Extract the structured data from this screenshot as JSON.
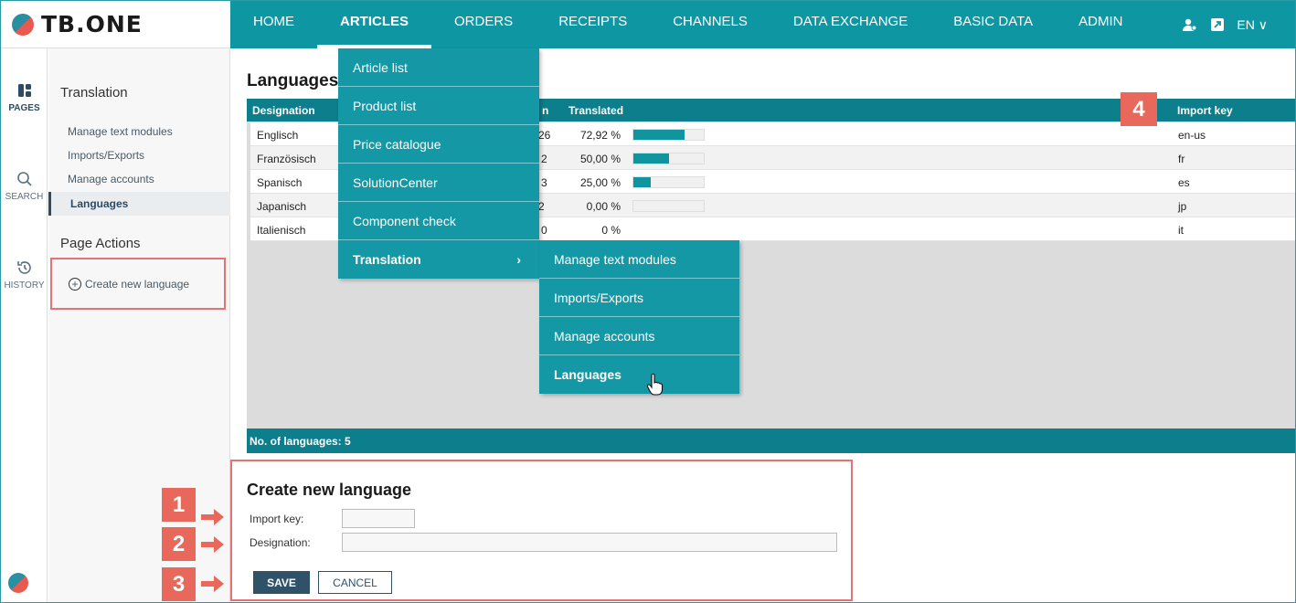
{
  "app": {
    "logo_text": "TB.ONE"
  },
  "nav": {
    "items": [
      "HOME",
      "ARTICLES",
      "ORDERS",
      "RECEIPTS",
      "CHANNELS",
      "DATA EXCHANGE",
      "BASIC DATA",
      "ADMIN"
    ],
    "active": "ARTICLES",
    "lang": "EN"
  },
  "rail": {
    "pages": "PAGES",
    "search": "SEARCH",
    "history": "HISTORY"
  },
  "side": {
    "section_title": "Translation",
    "links": [
      "Manage text modules",
      "Imports/Exports",
      "Manage accounts"
    ],
    "active_link": "Languages",
    "actions_title": "Page Actions",
    "create_link": "Create new language"
  },
  "main": {
    "title": "Languages",
    "columns": {
      "designation": "Designation",
      "partial": "n",
      "translated": "Translated",
      "import_key": "Import key"
    },
    "rows": [
      {
        "designation": "Englisch",
        "partial": "26",
        "translated": "72,92 %",
        "pct": 72.92,
        "import_key": "en-us"
      },
      {
        "designation": "Französisch",
        "partial": "2",
        "translated": "50,00 %",
        "pct": 50.0,
        "import_key": "fr"
      },
      {
        "designation": "Spanisch",
        "partial": "3",
        "translated": "25,00 %",
        "pct": 25.0,
        "import_key": "es"
      },
      {
        "designation": "Japanisch",
        "partial": "2",
        "translated": "0,00 %",
        "pct": 0,
        "import_key": "jp"
      },
      {
        "designation": "Italienisch",
        "partial": "0",
        "translated": "0 %",
        "pct": null,
        "import_key": "it"
      }
    ],
    "footer": "No. of languages: 5"
  },
  "dropdown": {
    "items": [
      "Article list",
      "Product list",
      "Price catalogue",
      "SolutionCenter",
      "Component check",
      "Translation"
    ],
    "submenu": [
      "Manage text modules",
      "Imports/Exports",
      "Manage accounts",
      "Languages"
    ]
  },
  "form": {
    "title": "Create new language",
    "import_key_label": "Import key:",
    "designation_label": "Designation:",
    "save": "SAVE",
    "cancel": "CANCEL"
  },
  "callouts": {
    "one": "1",
    "two": "2",
    "three": "3",
    "four": "4"
  },
  "colors": {
    "accent": "#0f96a3",
    "dark_teal": "#0d7e8b",
    "callout": "#e8695b",
    "button": "#2f5269"
  }
}
